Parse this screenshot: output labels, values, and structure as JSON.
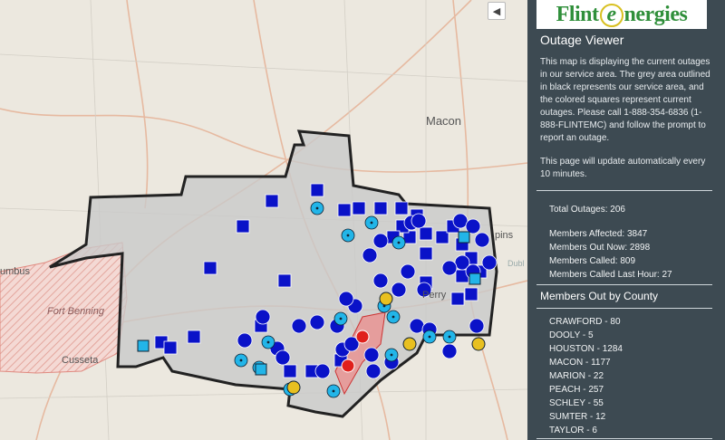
{
  "map": {
    "collapse_label": "◀",
    "places": {
      "columbus": "umbus",
      "fort_benning": "Fort Benning",
      "cusseta": "Cusseta",
      "macon": "Macon",
      "perry": "Perry",
      "robins": "pins",
      "dublin": "Dubl"
    }
  },
  "panel": {
    "logo_left": "Flint",
    "logo_e": "e",
    "logo_right": "nergies",
    "title": "Outage Viewer",
    "description": "This map is displaying the current outages in our service area. The grey area outlined in black represents our service area, and the colored squares represent current outages. Please call 1-888-354-6836 (1-888-FLINTEMC) and follow the prompt to report an outage.",
    "update_note": "This page will update automatically every 10 minutes.",
    "total_outages_label": "Total Outages:",
    "total_outages": "206",
    "members_affected_label": "Members Affected:",
    "members_affected": "3847",
    "members_out_now_label": "Members Out Now:",
    "members_out_now": "2898",
    "members_called_label": "Members Called:",
    "members_called": "809",
    "members_called_last_hour_label": "Members Called Last Hour:",
    "members_called_last_hour": "27",
    "county_heading": "Members Out by County",
    "counties": [
      "CRAWFORD - 80",
      "DOOLY - 5",
      "HOUSTON - 1284",
      "MACON - 1177",
      "MARION - 22",
      "PEACH - 257",
      "SCHLEY - 55",
      "SUMTER - 12",
      "TAYLOR - 6"
    ]
  },
  "colors": {
    "service_area": "#c9c9c9",
    "outline": "#222222",
    "outage_blue": "#0a12c8",
    "outage_light": "#22b5e8",
    "outage_red": "#e0201c",
    "outage_yellow": "#e8c020",
    "panel_bg": "#3d4a52"
  }
}
